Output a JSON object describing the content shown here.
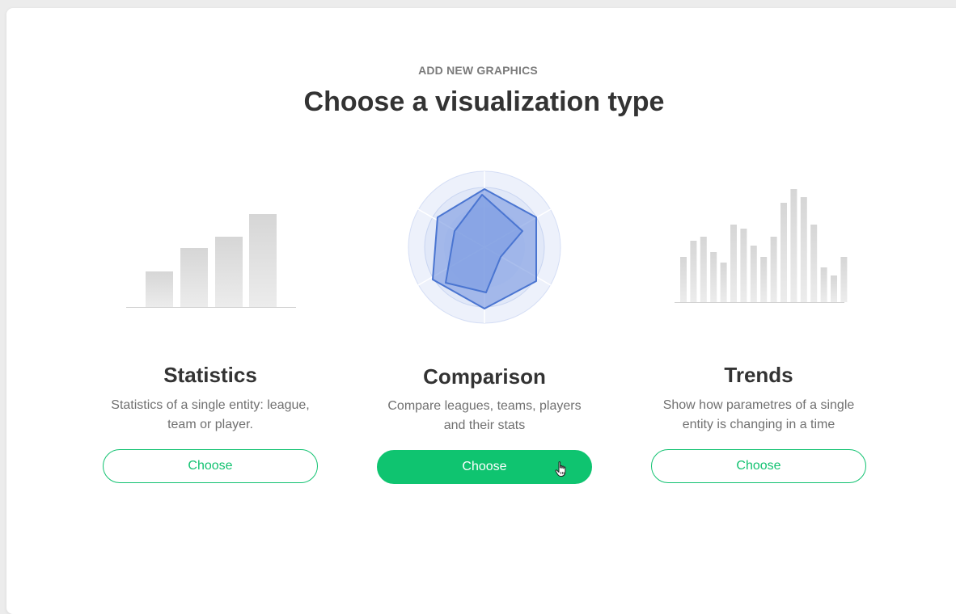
{
  "header": {
    "eyebrow": "ADD NEW GRAPHICS",
    "title": "Choose a visualization type"
  },
  "options": [
    {
      "id": "statistics",
      "name": "Statistics",
      "description": "Statistics of a single entity: league, team or player.",
      "button_label": "Choose",
      "state": "default",
      "illustration_icon": "bar-chart-icon"
    },
    {
      "id": "comparison",
      "name": "Comparison",
      "description": "Compare leagues, teams, players and their stats",
      "button_label": "Choose",
      "state": "hover",
      "illustration_icon": "radar-chart-icon"
    },
    {
      "id": "trends",
      "name": "Trends",
      "description": "Show how parametres of a single entity is changing in a time",
      "button_label": "Choose",
      "state": "default",
      "illustration_icon": "trend-chart-icon"
    }
  ],
  "colors": {
    "accent": "#0fc470",
    "accent_outline": "#12c271",
    "radar_fill": "#7f9ee3",
    "radar_stroke": "#4a75d1",
    "bar_gray": "#dadada"
  }
}
